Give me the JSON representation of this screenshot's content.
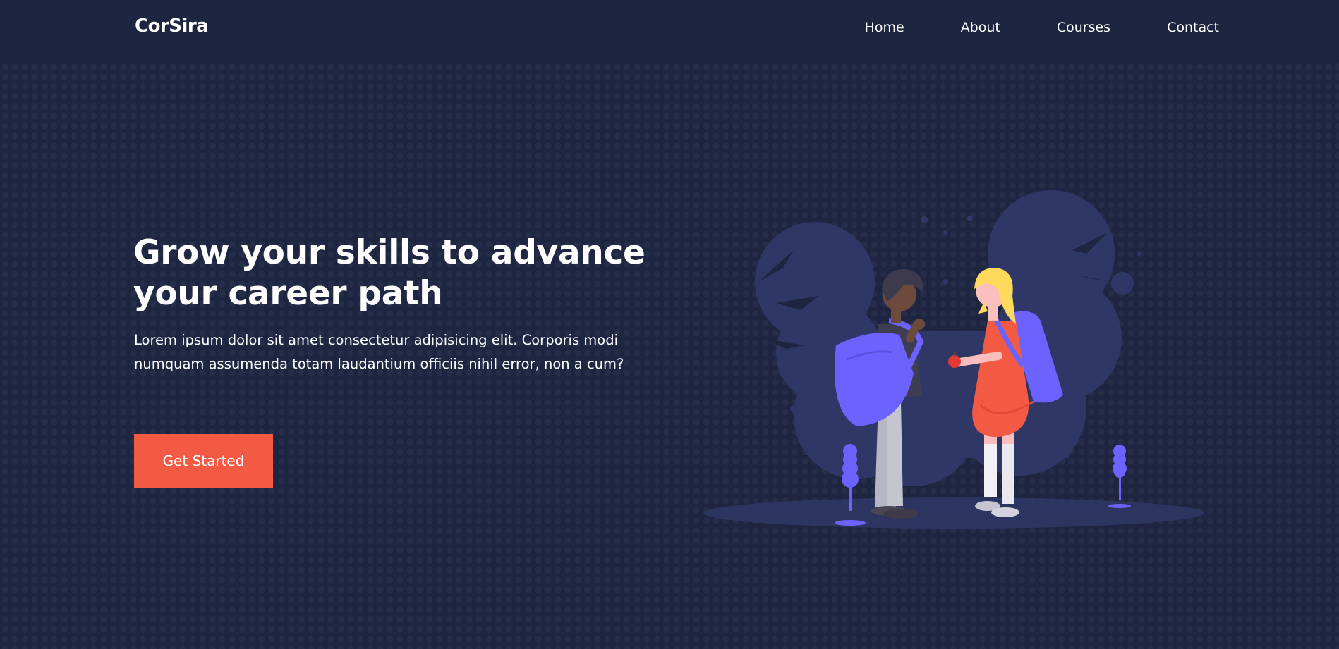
{
  "brand": {
    "name": "CorSira"
  },
  "nav": {
    "items": [
      {
        "label": "Home"
      },
      {
        "label": "About"
      },
      {
        "label": "Courses"
      },
      {
        "label": "Contact"
      }
    ]
  },
  "hero": {
    "title": "Grow your skills to advance your career path",
    "description": "Lorem ipsum dolor sit amet consectetur adipisicing elit. Corporis modi numquam assumenda totam laudantium officiis nihil error, non a cum?",
    "cta_label": "Get Started"
  },
  "colors": {
    "background": "#1e2541",
    "accent": "#f25a43",
    "illustration_primary": "#6c63ff",
    "blob": "#2f3766"
  }
}
